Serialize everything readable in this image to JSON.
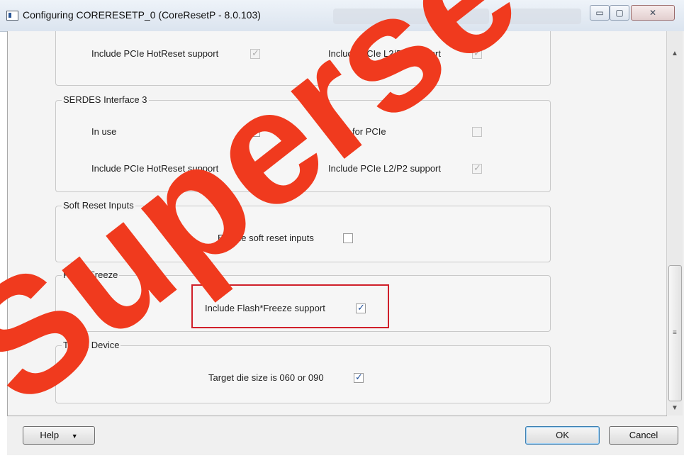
{
  "window": {
    "title": "Configuring CORERESETP_0 (CoreResetP - 8.0.103)",
    "minimize_glyph": "▭",
    "maximize_glyph": "▢",
    "close_glyph": "✕"
  },
  "serdes2": {
    "hotreset_label": "Include PCIe HotReset support",
    "hotreset_checked": true,
    "l2p2_label": "Include PCIe L2/P2 support",
    "l2p2_checked": true
  },
  "serdes3": {
    "title": "SERDES Interface 3",
    "inuse_label": "In use",
    "inuse_checked": false,
    "pcie_label": "Used for PCIe",
    "pcie_checked": false,
    "hotreset_label": "Include PCIe HotReset support",
    "hotreset_checked": true,
    "l2p2_label": "Include PCIe L2/P2 support",
    "l2p2_checked": true
  },
  "soft_reset": {
    "title": "Soft Reset Inputs",
    "enable_label": "Enable soft reset inputs",
    "enable_checked": false
  },
  "flash_freeze": {
    "title": "Flash*Freeze",
    "include_label": "Include Flash*Freeze support",
    "include_checked": true
  },
  "target_device": {
    "title": "Target Device",
    "die_label": "Target die size is 060 or 090",
    "die_checked": true
  },
  "buttons": {
    "help": "Help",
    "help_arrow": "▼",
    "ok": "OK",
    "cancel": "Cancel"
  },
  "watermark_text": "Superseded",
  "colors": {
    "highlight": "#d0202a",
    "watermark": "#f03a1e"
  }
}
